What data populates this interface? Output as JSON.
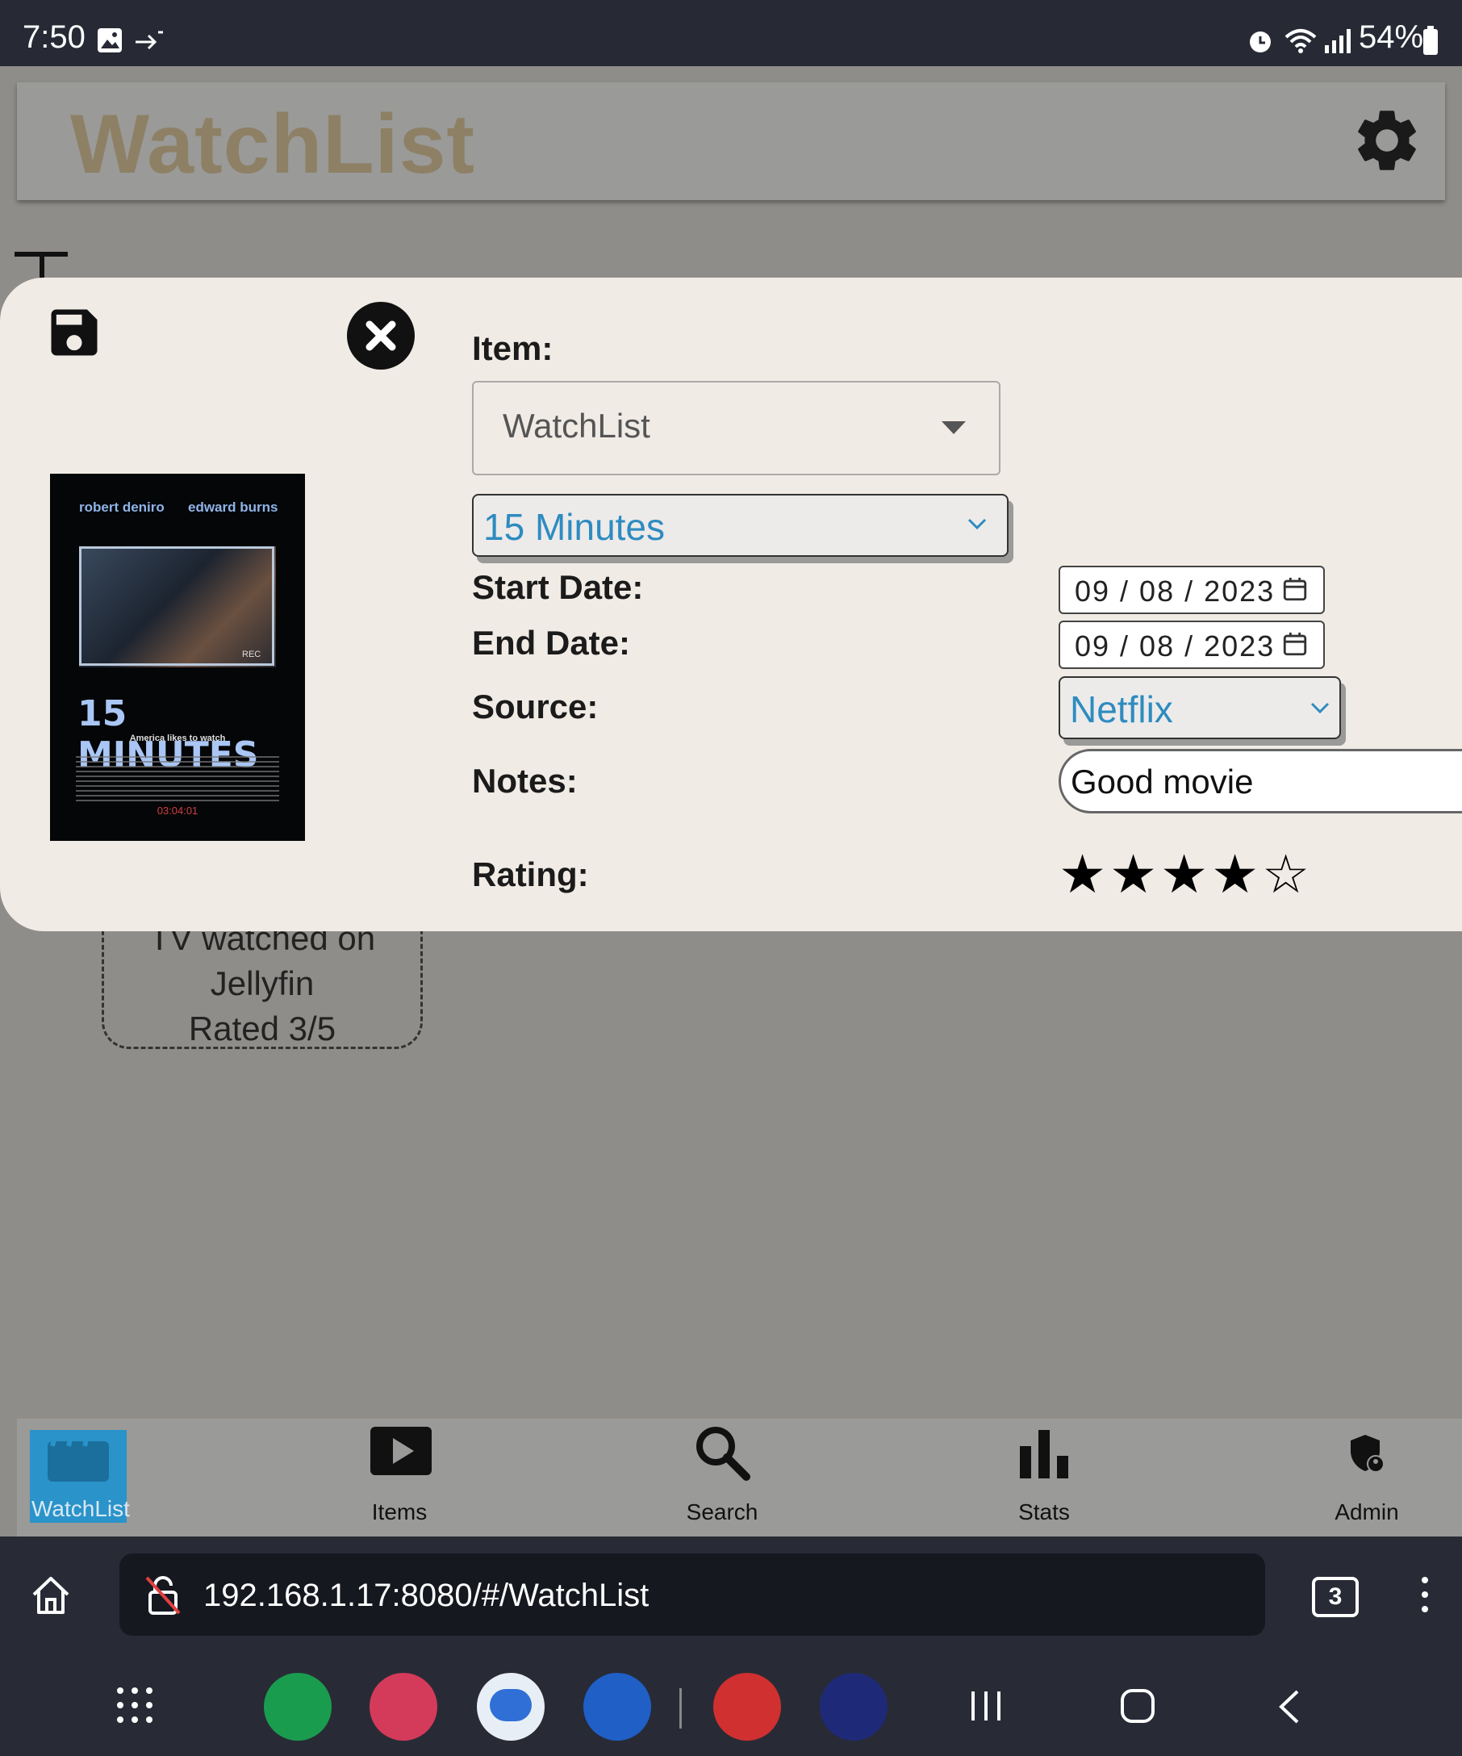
{
  "status": {
    "time": "7:50",
    "battery": "54%"
  },
  "header": {
    "title": "WatchList",
    "settings_icon": "gear-icon"
  },
  "background_card": {
    "line1": "TV watched on",
    "line2": "Jellyfin",
    "line3": "Rated 3/5"
  },
  "modal": {
    "item_label": "Item:",
    "item_select": "WatchList",
    "title_select": "15 Minutes",
    "start_label": "Start Date:",
    "start_date": "09 / 08 / 2023",
    "end_label": "End Date:",
    "end_date": "09 / 08 / 2023",
    "source_label": "Source:",
    "source_select": "Netflix",
    "notes_label": "Notes:",
    "notes_value": "Good movie",
    "rating_label": "Rating:",
    "rating": 4,
    "rating_max": 5,
    "poster": {
      "actor1": "robert deniro",
      "actor2": "edward burns",
      "title": "15 MINUTES",
      "tagline": "America likes to watch",
      "rec": "REC",
      "counter": "03:04:01"
    }
  },
  "bottom_nav": [
    {
      "label": "WatchList",
      "icon": "clapperboard-icon",
      "active": true
    },
    {
      "label": "Items",
      "icon": "play-icon"
    },
    {
      "label": "Search",
      "icon": "search-icon"
    },
    {
      "label": "Stats",
      "icon": "bar-chart-icon"
    },
    {
      "label": "Admin",
      "icon": "admin-shield-icon"
    }
  ],
  "browser": {
    "url": "192.168.1.17:8080/#/WatchList",
    "tab_count": "3"
  },
  "colors": {
    "accent": "#2e8bc0",
    "active_tab": "#2a93c9",
    "modal_bg": "#f1ebe5",
    "title_gold": "#8d8065"
  }
}
